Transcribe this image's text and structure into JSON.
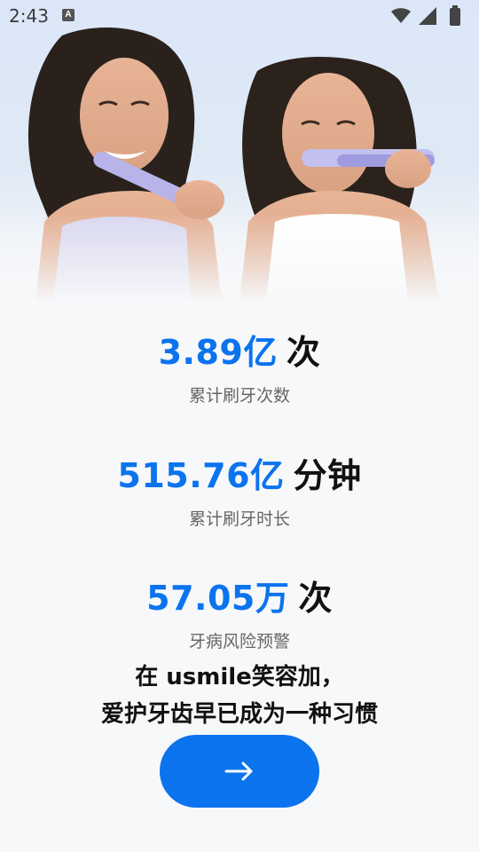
{
  "status_bar": {
    "time": "2:43",
    "notification_icon": "A"
  },
  "hero": {
    "image": "two-women-brushing-teeth-photo"
  },
  "stats": [
    {
      "value": "3.89亿",
      "unit": "次",
      "label": "累计刷牙次数"
    },
    {
      "value": "515.76亿",
      "unit": "分钟",
      "label": "累计刷牙时长"
    },
    {
      "value": "57.05万",
      "unit": "次",
      "label": "牙病风险预警"
    }
  ],
  "slogan": {
    "line1": "在 usmile笑容加，",
    "line2": "爱护牙齿早已成为一种习惯"
  },
  "next_button": {
    "icon": "arrow-right-icon",
    "color": "#0b73ee"
  },
  "colors": {
    "accent": "#0b73ee",
    "background": "#f7f8fa"
  }
}
